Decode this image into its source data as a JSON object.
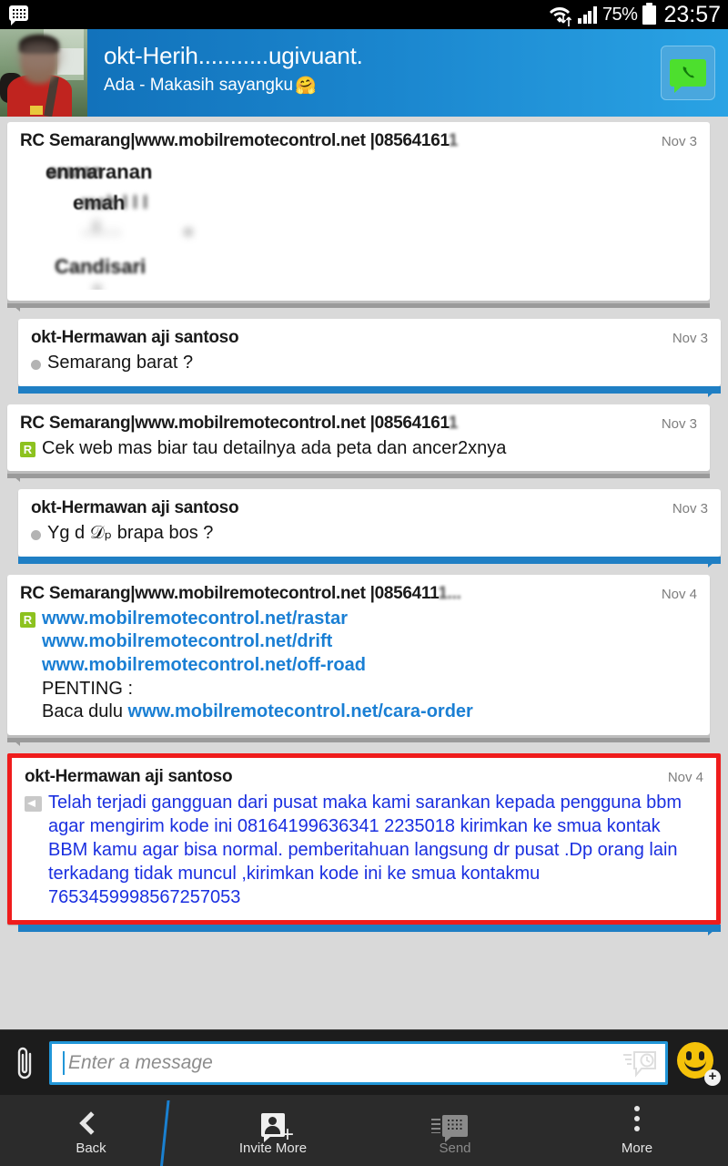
{
  "statusbar": {
    "app_icon": "bbm-logo-icon",
    "wifi_icon": "wifi-icon",
    "data_transfer_icon": "data-arrows-icon",
    "signal_icon": "signal-bars-icon",
    "battery_percent": "75%",
    "battery_icon": "battery-icon",
    "clock": "23:57"
  },
  "header": {
    "avatar": "contact-avatar",
    "title_visible": "okt-He",
    "title_blurred": "rih",
    "title_blurred2": "ugi",
    "subtitle": "Ada - Makasih sayangku",
    "subtitle_emoji": "🤗",
    "action_icon": "voice-chat-icon"
  },
  "messages": [
    {
      "id": "msg-1",
      "direction": "received",
      "sender": "RC Semarang|www.mobilremotecontrol.net |08564161",
      "sender_blurred": "1",
      "timestamp": "Nov 3",
      "content_type": "blurred",
      "blurred_lines": [
        "enmaranan",
        "emah",
        "Candisari"
      ]
    },
    {
      "id": "msg-2",
      "direction": "sent",
      "sender": "okt-Hermawan aji santoso",
      "timestamp": "Nov 3",
      "status_icon": "delivered-dot-icon",
      "text": "Semarang barat ?"
    },
    {
      "id": "msg-3",
      "direction": "received",
      "sender": "RC Semarang|www.mobilremotecontrol.net |08564161",
      "sender_blurred": "1",
      "timestamp": "Nov 3",
      "badge": "R",
      "badge_icon": "read-badge-icon",
      "text": "Cek web mas biar tau detailnya ada peta dan ancer2xnya"
    },
    {
      "id": "msg-4",
      "direction": "sent",
      "sender": "okt-Hermawan aji santoso",
      "timestamp": "Nov 3",
      "status_icon": "delivered-dot-icon",
      "text": "Yg d 𝒟ₚ brapa bos ?"
    },
    {
      "id": "msg-5",
      "direction": "received",
      "sender": "RC Semarang|www.mobilremotecontrol.net |0856411",
      "sender_blurred": "1...",
      "timestamp": "Nov 4",
      "badge": "R",
      "badge_icon": "read-badge-icon",
      "links": [
        "www.mobilremotecontrol.net/rastar",
        "www.mobilremotecontrol.net/drift",
        "www.mobilremotecontrol.net/off-road"
      ],
      "line_penting": "PENTING :",
      "line_baca_prefix": "Baca dulu ",
      "line_baca_link": "www.mobilremotecontrol.net/cara-order"
    },
    {
      "id": "msg-6",
      "direction": "sent",
      "highlight": "red-border",
      "highlight_color": "#ef1c1c",
      "sender": "okt-Hermawan aji santoso",
      "timestamp": "Nov 4",
      "badge_icon": "broadcast-icon",
      "text_color": "#1a2fe0",
      "text": "Telah terjadi gangguan dari pusat maka kami sarankan kepada pengguna bbm agar mengirim kode ini 08164199636341 2235018 kirimkan ke smua kontak BBM kamu agar bisa normal. pemberitahuan langsung dr pusat .Dp orang lain terkadang tidak muncul ,kirimkan kode ini ke smua kontakmu 7653459998567257053"
    }
  ],
  "input_bar": {
    "attach_icon": "paperclip-icon",
    "placeholder": "Enter a message",
    "value": "",
    "timed_message_icon": "timed-message-icon",
    "emoji_icon": "smiley-plus-icon"
  },
  "navbar": {
    "items": [
      {
        "label": "Back",
        "icon": "chevron-left-icon",
        "disabled": false
      },
      {
        "label": "Invite More",
        "icon": "add-person-icon",
        "disabled": false
      },
      {
        "label": "Send",
        "icon": "bbm-send-icon",
        "disabled": true
      },
      {
        "label": "More",
        "icon": "kebab-menu-icon",
        "disabled": false
      }
    ]
  },
  "colors": {
    "header_blue": "#1b87cf",
    "sent_bar_blue": "#1f7fc4",
    "received_bar_gray": "#9a9a9a",
    "chat_background": "#d9d9d9",
    "badge_green": "#8dc21f",
    "link_blue": "#1a7fd4",
    "spam_border": "#ef1c1c",
    "spam_text": "#1a2fe0"
  }
}
